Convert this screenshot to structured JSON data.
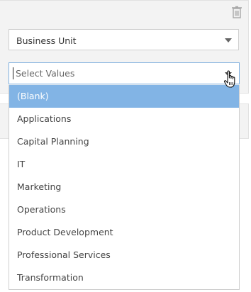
{
  "filter": {
    "field_label": "Business Unit",
    "values_placeholder": "Select Values",
    "options": [
      "(Blank)",
      "Applications",
      "Capital Planning",
      "IT",
      "Marketing",
      "Operations",
      "Product Development",
      "Professional Services",
      "Transformation"
    ],
    "highlighted_option": "(Blank)"
  },
  "icons": {
    "delete": "trash-icon",
    "dropdown": "chevron-down-icon",
    "cursor": "hand-pointer-icon"
  },
  "colors": {
    "highlight": "#82b4e5",
    "focus_border": "#7fb0df",
    "panel_background": "#f3f3f3"
  }
}
